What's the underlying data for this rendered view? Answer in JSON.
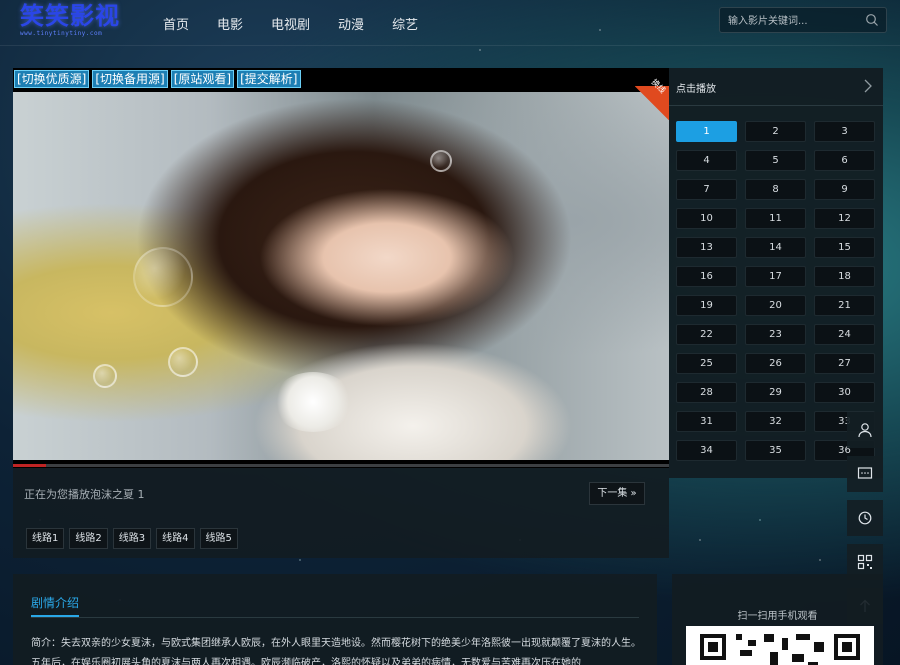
{
  "header": {
    "logo_text": "笑笑影视",
    "logo_subtext": "www.tinytinytiny.com",
    "nav": [
      "首页",
      "电影",
      "电视剧",
      "动漫",
      "综艺"
    ],
    "search_placeholder": "输入影片关键词..."
  },
  "player": {
    "source_buttons": [
      "[切换优质源]",
      "[切换备用源]",
      "[原站观看]",
      "[提交解析]"
    ],
    "corner_badge": "换线",
    "progress": 0.05,
    "now_playing": "正在为您播放泡沫之夏 1",
    "next_label": "下一集 »",
    "lines": [
      "线路1",
      "线路2",
      "线路3",
      "线路4",
      "线路5"
    ]
  },
  "episodes": {
    "title": "点击播放",
    "active": "1",
    "items": [
      "1",
      "2",
      "3",
      "4",
      "5",
      "6",
      "7",
      "8",
      "9",
      "10",
      "11",
      "12",
      "13",
      "14",
      "15",
      "16",
      "17",
      "18",
      "19",
      "20",
      "21",
      "22",
      "23",
      "24",
      "25",
      "26",
      "27",
      "28",
      "29",
      "30",
      "31",
      "32",
      "33",
      "34",
      "35",
      "36"
    ]
  },
  "synopsis": {
    "title": "剧情介绍",
    "text": "简介：失去双亲的少女夏沫，与欧式集团继承人欧辰，在外人眼里天造地设。然而樱花树下的绝美少年洛熙彼一出现就颠覆了夏沫的人生。五年后，在娱乐圈初展头角的夏沫与两人再次相遇。欧辰濒临破产，洛熙的怀疑以及弟弟的病情，无数爱与苦难再次压在她的"
  },
  "qr": {
    "label": "扫一扫用手机观看"
  },
  "colors": {
    "accent": "#1c9fe3",
    "logo": "#2a46e8",
    "progress": "#c02424",
    "badge": "#e04a1f"
  },
  "icons": [
    "search-icon",
    "chevron-right-icon",
    "user-icon",
    "comment-icon",
    "history-icon",
    "qrcode-icon",
    "arrow-up-icon"
  ]
}
